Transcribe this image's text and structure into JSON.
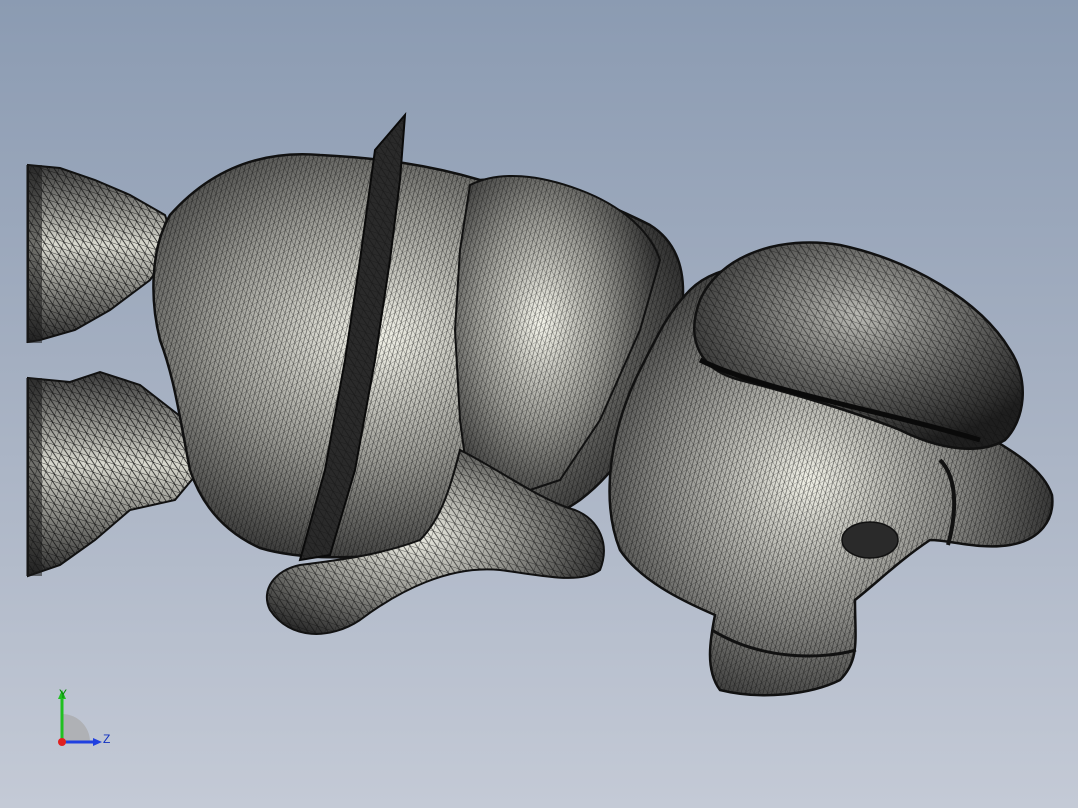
{
  "viewport": {
    "background_top": "#8b9bb2",
    "background_bottom": "#c4cad6"
  },
  "model": {
    "display_style": "mesh-wireframe-shaded",
    "mesh_line_color": "#111111",
    "surface_color": "#e8e8dc"
  },
  "triad": {
    "y_label": "Y",
    "z_label": "Z",
    "x_color": "#e02020",
    "y_color": "#20c020",
    "z_color": "#2040e0"
  }
}
